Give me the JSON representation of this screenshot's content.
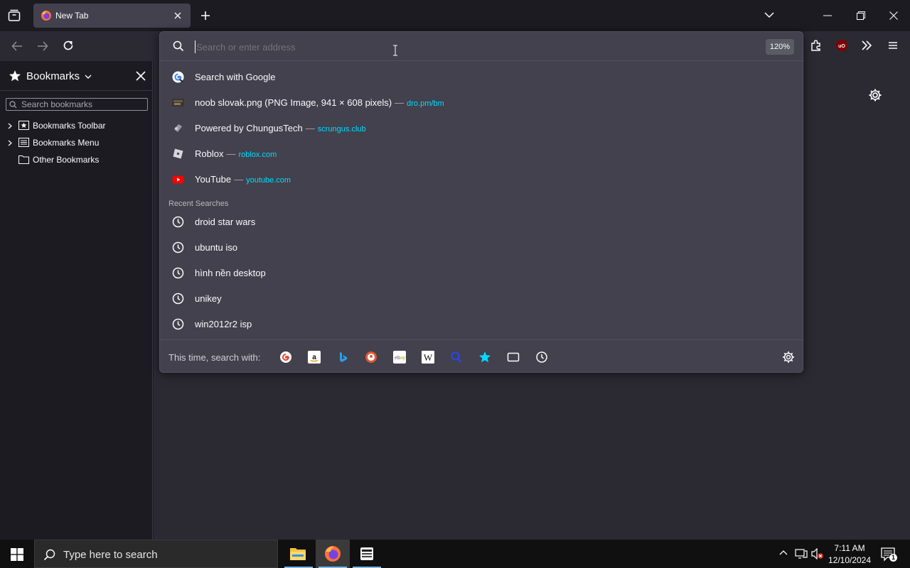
{
  "tab": {
    "title": "New Tab"
  },
  "urlbar": {
    "placeholder": "Search or enter address",
    "zoom": "120%"
  },
  "suggestions": [
    {
      "title": "Search with Google",
      "url": "",
      "icon": "google-icon"
    },
    {
      "title": "noob slovak.png (PNG Image, 941 × 608 pixels)",
      "url": "dro.pm/bm",
      "icon": "image-thumb-icon"
    },
    {
      "title": "Powered by ChungusTech",
      "url": "scrungus.club",
      "icon": "chungustech-icon"
    },
    {
      "title": "Roblox",
      "url": "roblox.com",
      "icon": "roblox-icon"
    },
    {
      "title": "YouTube",
      "url": "youtube.com",
      "icon": "youtube-icon"
    }
  ],
  "recent": {
    "label": "Recent Searches",
    "items": [
      "droid star wars",
      "ubuntu iso",
      "hình nền desktop",
      "unikey",
      "win2012r2 isp"
    ]
  },
  "search_with": {
    "label": "This time, search with:",
    "engines": [
      "google-icon",
      "amazon-icon",
      "bing-icon",
      "duckduckgo-icon",
      "ebay-icon",
      "wikipedia-icon",
      "search-engine-icon",
      "bookmarks-star-icon",
      "tabs-icon",
      "history-icon"
    ]
  },
  "sidebar": {
    "title": "Bookmarks",
    "search_placeholder": "Search bookmarks",
    "items": [
      {
        "label": "Bookmarks Toolbar"
      },
      {
        "label": "Bookmarks Menu"
      },
      {
        "label": "Other Bookmarks"
      }
    ]
  },
  "taskbar": {
    "search_placeholder": "Type here to search",
    "time": "7:11 AM",
    "date": "12/10/2024",
    "notification_count": "1"
  },
  "colors": {
    "accent": "#00ddff",
    "panel": "#42414d",
    "toolbar": "#2b2a33"
  }
}
